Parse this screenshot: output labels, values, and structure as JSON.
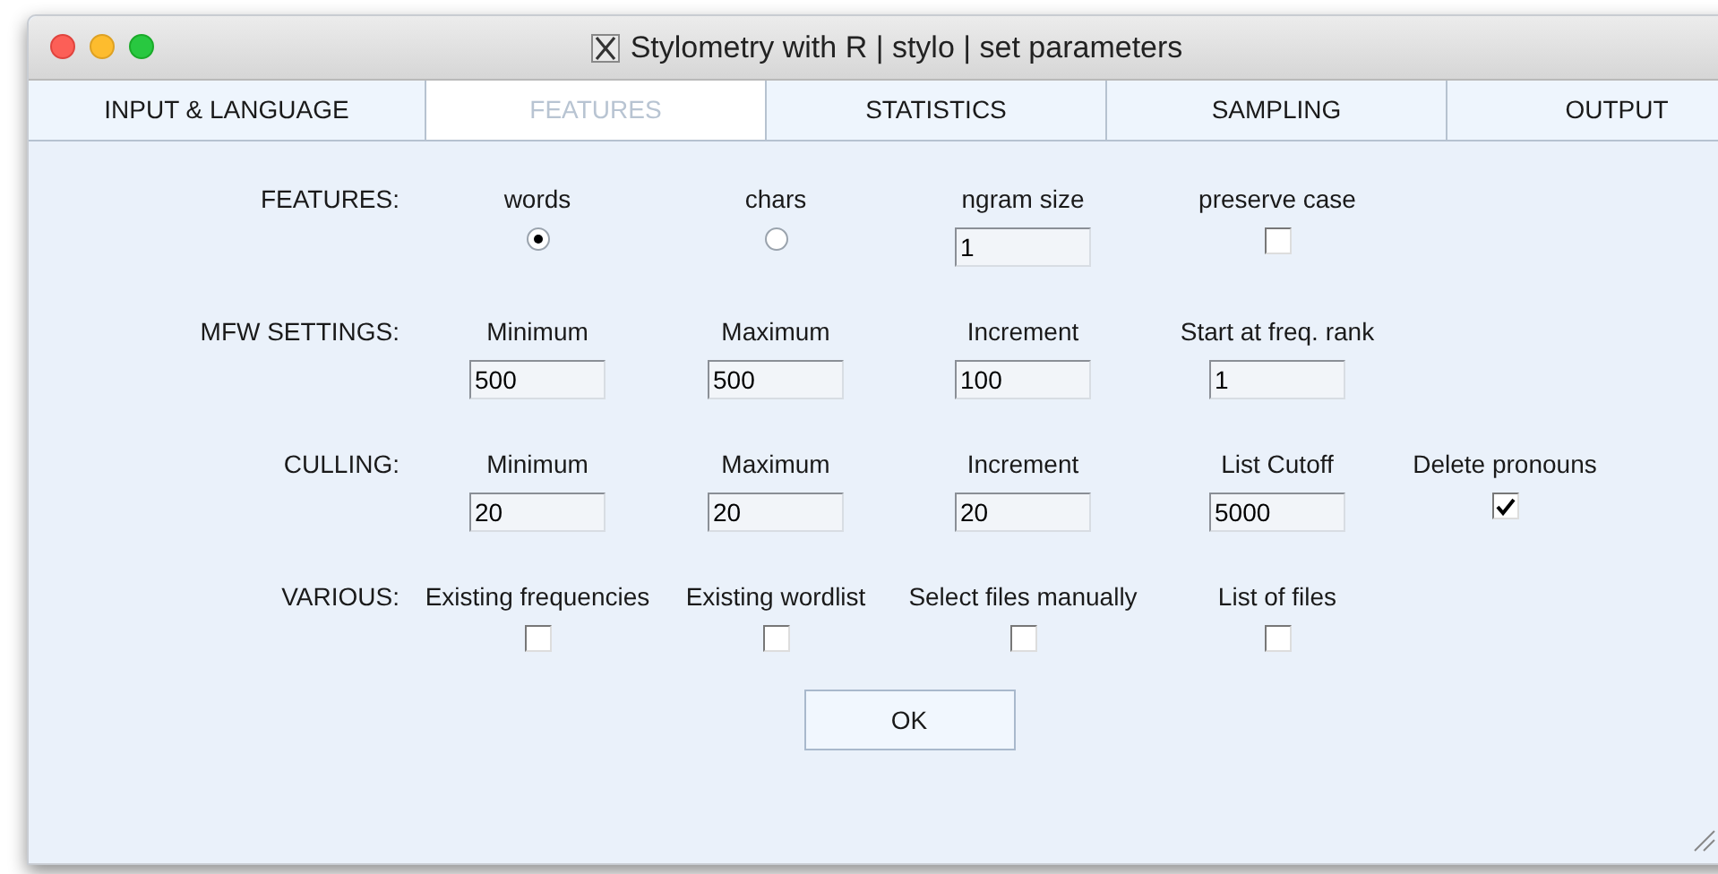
{
  "window": {
    "title": "Stylometry with R | stylo | set parameters"
  },
  "tabs": [
    {
      "label": "INPUT & LANGUAGE",
      "selected": false
    },
    {
      "label": "FEATURES",
      "selected": true
    },
    {
      "label": "STATISTICS",
      "selected": false
    },
    {
      "label": "SAMPLING",
      "selected": false
    },
    {
      "label": "OUTPUT",
      "selected": false
    }
  ],
  "sections": [
    {
      "label": "FEATURES:",
      "items": [
        {
          "kind": "radio",
          "caption": "words",
          "selected": true
        },
        {
          "kind": "radio",
          "caption": "chars",
          "selected": false
        },
        {
          "kind": "field",
          "caption": "ngram size",
          "value": "1"
        },
        {
          "kind": "checkbox",
          "caption": "preserve case",
          "checked": false
        }
      ]
    },
    {
      "label": "MFW SETTINGS:",
      "items": [
        {
          "kind": "field",
          "caption": "Minimum",
          "value": "500"
        },
        {
          "kind": "field",
          "caption": "Maximum",
          "value": "500"
        },
        {
          "kind": "field",
          "caption": "Increment",
          "value": "100"
        },
        {
          "kind": "field",
          "caption": "Start at freq. rank",
          "value": "1"
        }
      ]
    },
    {
      "label": "CULLING:",
      "items": [
        {
          "kind": "field",
          "caption": "Minimum",
          "value": "20"
        },
        {
          "kind": "field",
          "caption": "Maximum",
          "value": "20"
        },
        {
          "kind": "field",
          "caption": "Increment",
          "value": "20"
        },
        {
          "kind": "field",
          "caption": "List Cutoff",
          "value": "5000"
        },
        {
          "kind": "checkbox",
          "caption": "Delete pronouns",
          "checked": true
        }
      ]
    },
    {
      "label": "VARIOUS:",
      "items": [
        {
          "kind": "checkbox",
          "caption": "Existing frequencies",
          "checked": false
        },
        {
          "kind": "checkbox",
          "caption": "Existing wordlist",
          "checked": false
        },
        {
          "kind": "checkbox",
          "caption": "Select files manually",
          "checked": false
        },
        {
          "kind": "checkbox",
          "caption": "List of files",
          "checked": false
        }
      ]
    }
  ],
  "ok_button": "OK"
}
